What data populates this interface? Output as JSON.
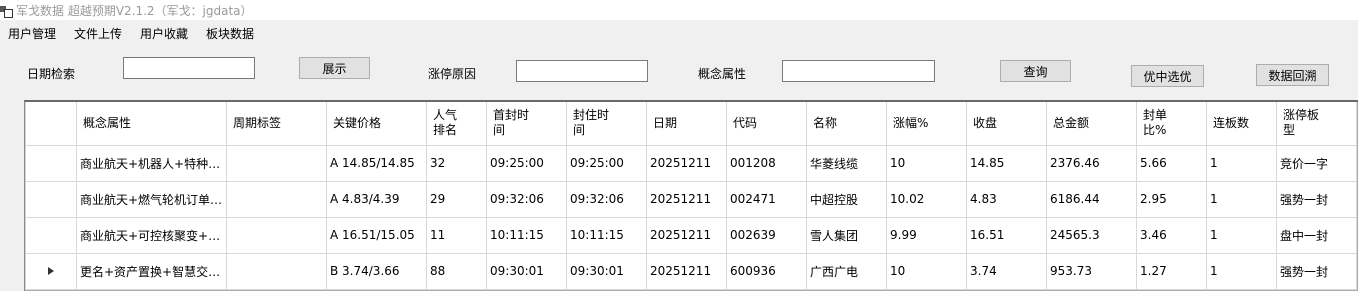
{
  "window": {
    "title": "军戈数据 超越预期V2.1.2（军戈：jgdata）"
  },
  "menu": [
    "用户管理",
    "文件上传",
    "用户收藏",
    "板块数据"
  ],
  "search": {
    "date_label": "日期检索",
    "date_value": "",
    "show_button": "展示",
    "reason_label": "涨停原因",
    "reason_value": "",
    "concept_label": "概念属性",
    "concept_value": "",
    "query_button": "查询",
    "best_button": "优中选优",
    "backtrack_button": "数据回溯"
  },
  "table": {
    "headers": [
      "概念属性",
      "周期标签",
      "关键价格",
      "人气排名",
      "首封时间",
      "封住时间",
      "日期",
      "代码",
      "名称",
      "涨幅%",
      "收盘",
      "总金额",
      "封单比%",
      "连板数",
      "涨停板型"
    ],
    "rows": [
      [
        "商业航天+机器人+特种…",
        "",
        "A 14.85/14.85",
        "32",
        "09:25:00",
        "09:25:00",
        "20251211",
        "001208",
        "华菱线缆",
        "10",
        "14.85",
        "2376.46",
        "5.66",
        "1",
        "竞价一字"
      ],
      [
        "商业航天+燃气轮机订单…",
        "",
        "A 4.83/4.39",
        "29",
        "09:32:06",
        "09:32:06",
        "20251211",
        "002471",
        "中超控股",
        "10.02",
        "4.83",
        "6186.44",
        "2.95",
        "1",
        "强势一封"
      ],
      [
        "商业航天+可控核聚变+…",
        "",
        "A 16.51/15.05",
        "11",
        "10:11:15",
        "10:11:15",
        "20251211",
        "002639",
        "雪人集团",
        "9.99",
        "16.51",
        "24565.3",
        "3.46",
        "1",
        "盘中一封"
      ],
      [
        "更名+资产置换+智慧交…",
        "",
        "B 3.74/3.66",
        "88",
        "09:30:01",
        "09:30:01",
        "20251211",
        "600936",
        "广西广电",
        "10",
        "3.74",
        "953.73",
        "1.27",
        "1",
        "强势一封"
      ]
    ],
    "current_row": 3
  }
}
